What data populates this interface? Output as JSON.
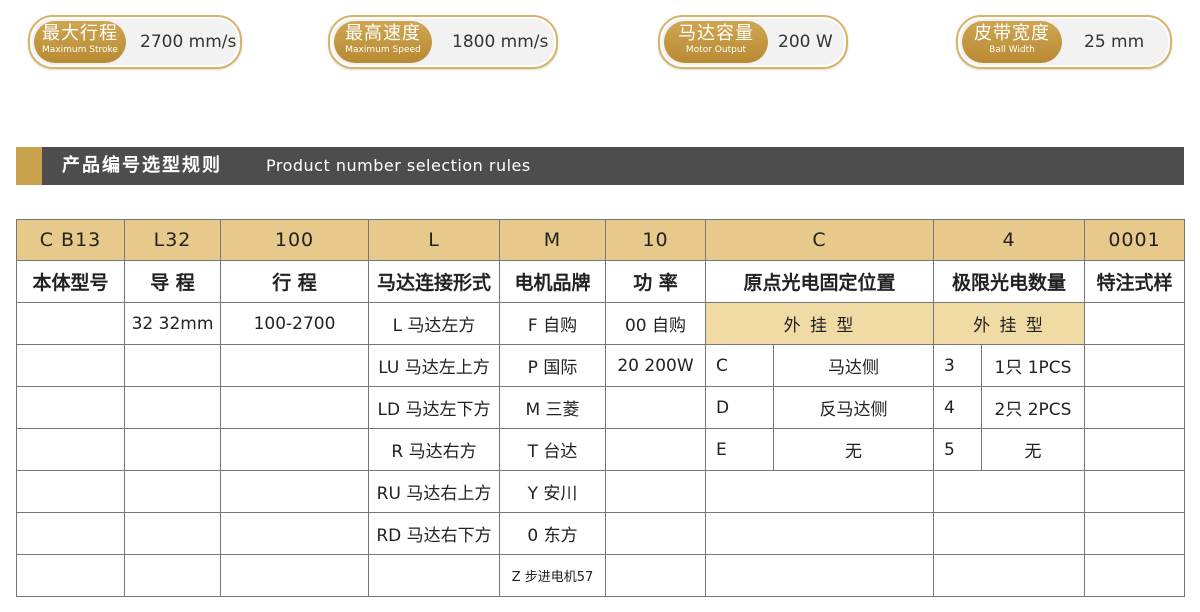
{
  "specs": [
    {
      "zh": "最大行程",
      "en": "Maximum Stroke",
      "value": "2700 mm/s"
    },
    {
      "zh": "最高速度",
      "en": "Maximum Speed",
      "value": "1800 mm/s"
    },
    {
      "zh": "马达容量",
      "en": "Motor Output",
      "value": "200 W"
    },
    {
      "zh": "皮带宽度",
      "en": "Ball Width",
      "value": "25 mm"
    }
  ],
  "section": {
    "title_zh": "产品编号选型规则",
    "title_en": "Product number selection rules"
  },
  "colors": {
    "gold": "#c9a24e",
    "gold_light": "#e7c98b",
    "header_bg": "#4d4d4d"
  },
  "table": {
    "codes": [
      "C B13",
      "L32",
      "100",
      "L",
      "M",
      "10",
      "C",
      "4",
      "0001"
    ],
    "headers": [
      "本体型号",
      "导 程",
      "行 程",
      "马达连接形式",
      "电机品牌",
      "功 率",
      "原点光电固定位置",
      "极限光电数量",
      "特注式样"
    ],
    "row1": {
      "lead": "32 32mm",
      "stroke": "100-2700",
      "motor_conn": "L 马达左方",
      "brand": "F  自购",
      "power": "00 自购",
      "origin_mount": "外 挂 型",
      "limit_mount": "外 挂 型"
    },
    "motor_conn": [
      "LU 马达左上方",
      "LD 马达左下方",
      "R 马达右方",
      "RU 马达右上方",
      "RD 马达右下方"
    ],
    "brands": [
      "P  国际",
      "M  三菱",
      "T  台达",
      "Y  安川",
      "0  东方",
      "Z 步进电机57"
    ],
    "power2": "20  200W",
    "origin": [
      {
        "code": "C",
        "label": "马达侧"
      },
      {
        "code": "D",
        "label": "反马达侧"
      },
      {
        "code": "E",
        "label": "无"
      }
    ],
    "limit": [
      {
        "code": "3",
        "label": "1只 1PCS"
      },
      {
        "code": "4",
        "label": "2只 2PCS"
      },
      {
        "code": "5",
        "label": "无"
      }
    ]
  }
}
